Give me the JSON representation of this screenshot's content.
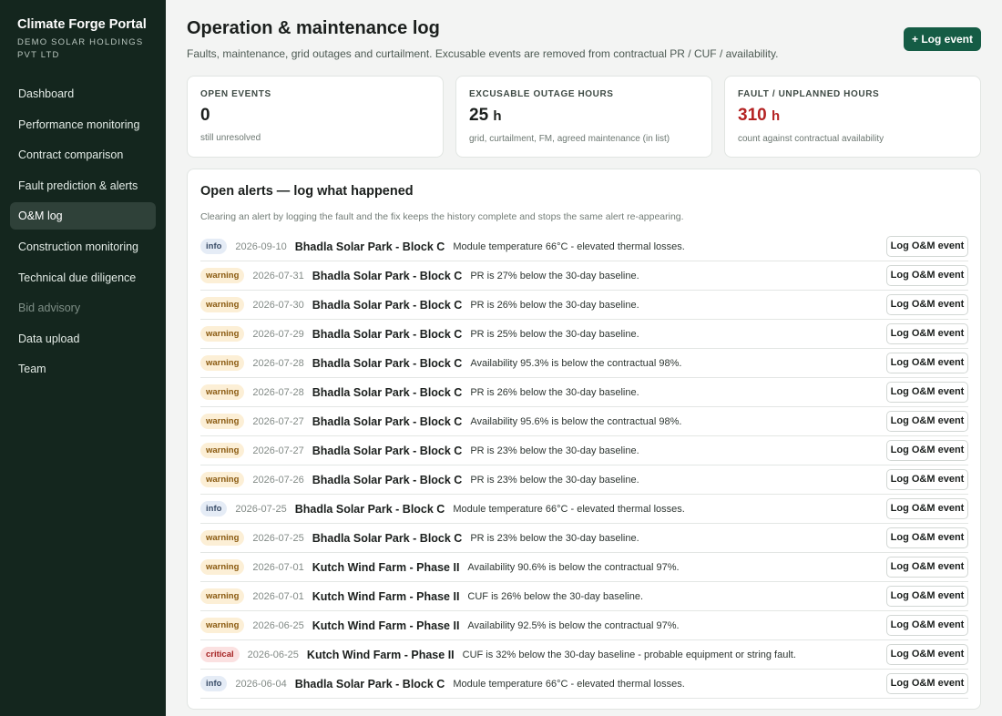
{
  "brand": {
    "title": "Climate Forge Portal",
    "subtitle": "DEMO SOLAR HOLDINGS PVT LTD"
  },
  "nav": [
    {
      "label": "Dashboard",
      "state": "normal"
    },
    {
      "label": "Performance monitoring",
      "state": "normal"
    },
    {
      "label": "Contract comparison",
      "state": "normal"
    },
    {
      "label": "Fault prediction & alerts",
      "state": "normal"
    },
    {
      "label": "O&M log",
      "state": "active"
    },
    {
      "label": "Construction monitoring",
      "state": "normal"
    },
    {
      "label": "Technical due diligence",
      "state": "normal"
    },
    {
      "label": "Bid advisory",
      "state": "disabled"
    },
    {
      "label": "Data upload",
      "state": "normal"
    },
    {
      "label": "Team",
      "state": "normal"
    }
  ],
  "header": {
    "title": "Operation & maintenance log",
    "subtitle": "Faults, maintenance, grid outages and curtailment. Excusable events are removed from contractual PR / CUF / availability.",
    "log_button": "+ Log event"
  },
  "cards": [
    {
      "label": "OPEN EVENTS",
      "value": "0",
      "unit": "",
      "note": "still unresolved",
      "highlight": false
    },
    {
      "label": "EXCUSABLE OUTAGE HOURS",
      "value": "25",
      "unit": "h",
      "note": "grid, curtailment, FM, agreed maintenance (in list)",
      "highlight": false
    },
    {
      "label": "FAULT / UNPLANNED HOURS",
      "value": "310",
      "unit": "h",
      "note": "count against contractual availability",
      "highlight": true
    }
  ],
  "alerts": {
    "title": "Open alerts — log what happened",
    "subtitle": "Clearing an alert by logging the fault and the fix keeps the history complete and stops the same alert re-appearing.",
    "action_label": "Log O&M event",
    "items": [
      {
        "severity": "info",
        "date": "2026-09-10",
        "site": "Bhadla Solar Park - Block C",
        "message": "Module temperature 66°C - elevated thermal losses."
      },
      {
        "severity": "warning",
        "date": "2026-07-31",
        "site": "Bhadla Solar Park - Block C",
        "message": "PR is 27% below the 30-day baseline."
      },
      {
        "severity": "warning",
        "date": "2026-07-30",
        "site": "Bhadla Solar Park - Block C",
        "message": "PR is 26% below the 30-day baseline."
      },
      {
        "severity": "warning",
        "date": "2026-07-29",
        "site": "Bhadla Solar Park - Block C",
        "message": "PR is 25% below the 30-day baseline."
      },
      {
        "severity": "warning",
        "date": "2026-07-28",
        "site": "Bhadla Solar Park - Block C",
        "message": "Availability 95.3% is below the contractual 98%."
      },
      {
        "severity": "warning",
        "date": "2026-07-28",
        "site": "Bhadla Solar Park - Block C",
        "message": "PR is 26% below the 30-day baseline."
      },
      {
        "severity": "warning",
        "date": "2026-07-27",
        "site": "Bhadla Solar Park - Block C",
        "message": "Availability 95.6% is below the contractual 98%."
      },
      {
        "severity": "warning",
        "date": "2026-07-27",
        "site": "Bhadla Solar Park - Block C",
        "message": "PR is 23% below the 30-day baseline."
      },
      {
        "severity": "warning",
        "date": "2026-07-26",
        "site": "Bhadla Solar Park - Block C",
        "message": "PR is 23% below the 30-day baseline."
      },
      {
        "severity": "info",
        "date": "2026-07-25",
        "site": "Bhadla Solar Park - Block C",
        "message": "Module temperature 66°C - elevated thermal losses."
      },
      {
        "severity": "warning",
        "date": "2026-07-25",
        "site": "Bhadla Solar Park - Block C",
        "message": "PR is 23% below the 30-day baseline."
      },
      {
        "severity": "warning",
        "date": "2026-07-01",
        "site": "Kutch Wind Farm - Phase II",
        "message": "Availability 90.6% is below the contractual 97%."
      },
      {
        "severity": "warning",
        "date": "2026-07-01",
        "site": "Kutch Wind Farm - Phase II",
        "message": "CUF is 26% below the 30-day baseline."
      },
      {
        "severity": "warning",
        "date": "2026-06-25",
        "site": "Kutch Wind Farm - Phase II",
        "message": "Availability 92.5% is below the contractual 97%."
      },
      {
        "severity": "critical",
        "date": "2026-06-25",
        "site": "Kutch Wind Farm - Phase II",
        "message": "CUF is 32% below the 30-day baseline - probable equipment or string fault."
      },
      {
        "severity": "info",
        "date": "2026-06-04",
        "site": "Bhadla Solar Park - Block C",
        "message": "Module temperature 66°C - elevated thermal losses."
      }
    ]
  }
}
